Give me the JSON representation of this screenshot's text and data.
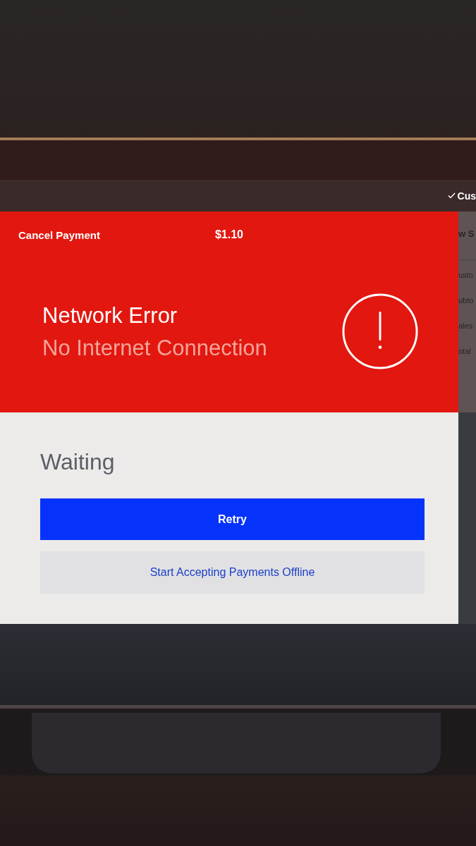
{
  "nav_bar": {
    "label": "Cus"
  },
  "payment_modal": {
    "cancel_button": "Cancel Payment",
    "amount": "$1.10",
    "error_title": "Network Error",
    "error_message": "No Internet Connection",
    "status": "Waiting",
    "buttons": [
      {
        "label": "Retry",
        "kind": "primary"
      },
      {
        "label": "Start Accepting Payments Offline",
        "kind": "secondary"
      }
    ]
  },
  "background_panel": {
    "heading": "w S",
    "rows": [
      "usto",
      "ubto",
      "ales",
      "otal"
    ]
  }
}
